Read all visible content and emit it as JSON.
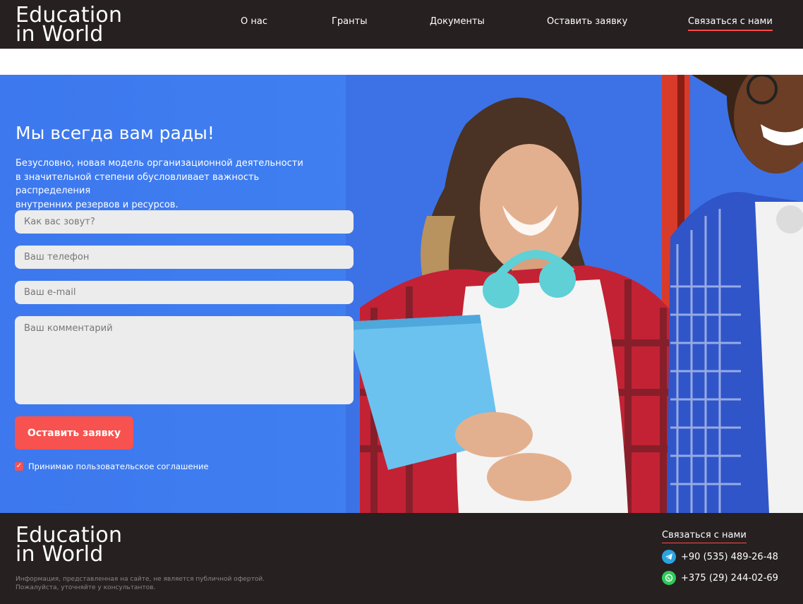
{
  "header": {
    "logo": {
      "line1": "Education",
      "line2": "in World"
    },
    "nav": {
      "about": "О нас",
      "grants": "Гранты",
      "documents": "Документы",
      "apply": "Оставить заявку",
      "contact": "Связаться с нами"
    }
  },
  "hero": {
    "title": "Мы всегда вам рады!",
    "text_line1": "Безусловно, новая модель организационной деятельности",
    "text_line2": "в значительной степени обусловливает важность распределения",
    "text_line3": "внутренних резервов и ресурсов.",
    "form": {
      "name_placeholder": "Как вас зовут?",
      "phone_placeholder": "Ваш телефон",
      "email_placeholder": "Ваш e-mail",
      "comment_placeholder": "Ваш комментарий",
      "submit_label": "Оставить заявку",
      "agree_label": "Принимаю пользовательское соглашение",
      "agree_checked": true
    }
  },
  "footer": {
    "logo": {
      "line1": "Education",
      "line2": "in World"
    },
    "disclaimer_line1": "Информация, представленная на сайте, не является публичной офертой.",
    "disclaimer_line2": "Пожалуйста, уточняйте у консультантов.",
    "contact_title": "Связаться с нами",
    "contacts": [
      {
        "icon": "telegram-icon",
        "phone": "+90 (535) 489-26-48"
      },
      {
        "icon": "whatsapp-icon",
        "phone": "+375 (29) 244-02-69"
      }
    ]
  },
  "colors": {
    "dark": "#262020",
    "accent": "#f7524f",
    "hero_blue": "#3f7ff0",
    "field_bg": "#ececec"
  }
}
